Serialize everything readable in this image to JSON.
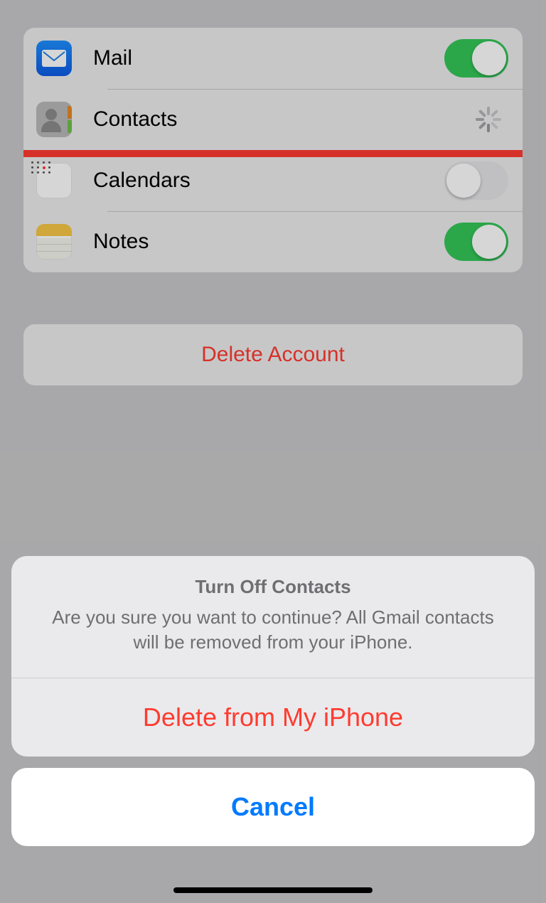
{
  "services": {
    "mail": {
      "label": "Mail",
      "state": "on"
    },
    "contacts": {
      "label": "Contacts",
      "state": "loading"
    },
    "calendars": {
      "label": "Calendars",
      "state": "off"
    },
    "notes": {
      "label": "Notes",
      "state": "on"
    }
  },
  "delete_account_label": "Delete Account",
  "sheet": {
    "title": "Turn Off Contacts",
    "message": "Are you sure you want to continue? All Gmail contacts will be removed from your iPhone.",
    "destructive_label": "Delete from My iPhone",
    "cancel_label": "Cancel"
  },
  "colors": {
    "toggle_on": "#34c759",
    "destructive": "#ff3b30",
    "primary": "#007aff"
  }
}
